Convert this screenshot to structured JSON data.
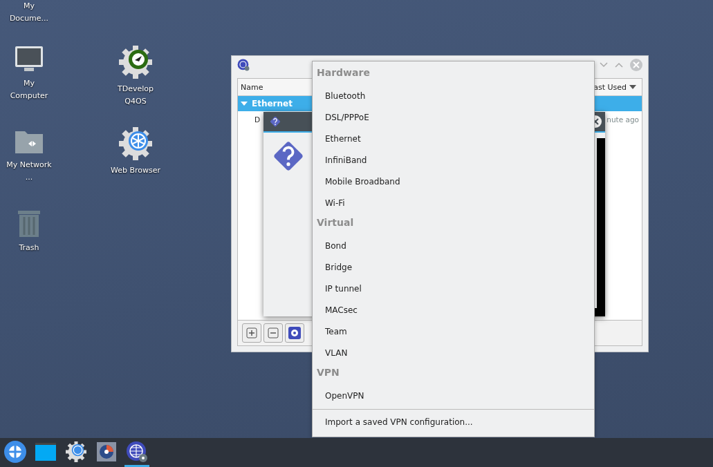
{
  "desktop_icons": [
    {
      "kind": "none",
      "label": "My Docume..."
    },
    {
      "kind": "computer",
      "label": "My Computer"
    },
    {
      "kind": "tdevelop",
      "label": "TDevelop Q4OS"
    },
    {
      "kind": "network",
      "label": "My Network ..."
    },
    {
      "kind": "browser",
      "label": "Web Browser"
    },
    {
      "kind": "trash",
      "label": "Trash"
    }
  ],
  "window": {
    "columns": [
      "Name",
      "ast Used"
    ],
    "group": {
      "label": "Ethernet",
      "expanded": true,
      "selected": true
    },
    "row": [
      "D",
      "nute ago"
    ]
  },
  "menu": {
    "sections": [
      {
        "title": "Hardware",
        "items": [
          "Bluetooth",
          "DSL/PPPoE",
          "Ethernet",
          "InfiniBand",
          "Mobile Broadband",
          "Wi-Fi"
        ]
      },
      {
        "title": "Virtual",
        "items": [
          "Bond",
          "Bridge",
          "IP tunnel",
          "MACsec",
          "Team",
          "VLAN"
        ]
      },
      {
        "title": "VPN",
        "items": [
          "OpenVPN"
        ]
      }
    ],
    "footer": "Import a saved VPN configuration..."
  },
  "taskbar": [
    {
      "kind": "launcher",
      "selected": false
    },
    {
      "kind": "desktop",
      "selected": false
    },
    {
      "kind": "browser",
      "selected": false
    },
    {
      "kind": "monitor",
      "selected": false
    },
    {
      "kind": "network",
      "selected": true
    }
  ]
}
